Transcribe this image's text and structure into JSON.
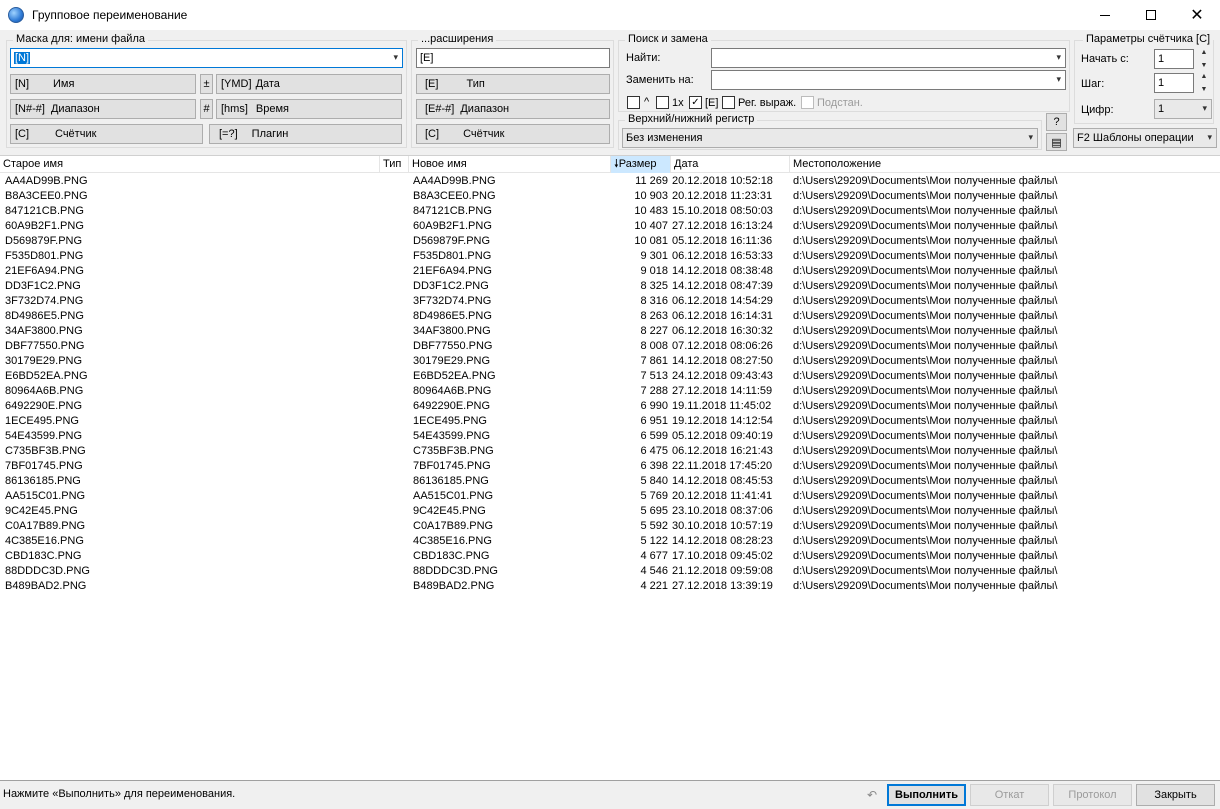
{
  "window": {
    "title": "Групповое переименование",
    "minimize_icon": "minimize-icon",
    "maximize_icon": "maximize-icon",
    "close_icon": "close-icon"
  },
  "filename_mask": {
    "title": "Маска для: имени файла",
    "value": "[N]",
    "buttons": [
      {
        "code": "[N]",
        "label": "Имя"
      },
      {
        "code": "[N#-#]",
        "label": "Диапазон"
      },
      {
        "code": "[C]",
        "label": "Счётчик"
      }
    ],
    "plus": "±",
    "hash": "#",
    "buttons_right": [
      {
        "code": "[YMD]",
        "label": "Дата"
      },
      {
        "code": "[hms]",
        "label": "Время"
      },
      {
        "code": "[=?]",
        "label": "Плагин"
      }
    ]
  },
  "extension_mask": {
    "title": "...расширения",
    "value": "[E]",
    "buttons": [
      {
        "code": "[E]",
        "label": "Тип"
      },
      {
        "code": "[E#-#]",
        "label": "Диапазон"
      },
      {
        "code": "[C]",
        "label": "Счётчик"
      }
    ]
  },
  "search_replace": {
    "title": "Поиск и замена",
    "find_label": "Найти:",
    "find_value": "",
    "replace_label": "Заменить на:",
    "replace_value": "",
    "opt_caret": "^",
    "opt_1x": "1x",
    "opt_ext": "[E]",
    "opt_regex": "Рег. выраж.",
    "opt_subst": "Подстан.",
    "caret_checked": false,
    "once_checked": false,
    "ext_checked": true,
    "regex_checked": false,
    "subst_checked": false
  },
  "case": {
    "title": "Верхний/нижний регистр",
    "value": "Без изменения",
    "help": "?"
  },
  "counter": {
    "title": "Параметры счётчика [C]",
    "start_label": "Начать с:",
    "start_value": "1",
    "step_label": "Шаг:",
    "step_value": "1",
    "digits_label": "Цифр:",
    "digits_value": "1",
    "templates": "F2 Шаблоны операции"
  },
  "columns": {
    "old": "Старое имя",
    "type": "Тип",
    "new": "Новое имя",
    "size": "Размер",
    "date": "Дата",
    "location": "Местоположение"
  },
  "files": [
    {
      "old": "AA4AD99B.PNG",
      "new": "AA4AD99B.PNG",
      "size": "11 269",
      "date": "20.12.2018 10:52:18",
      "loc": "d:\\Users\\29209\\Documents\\Мои полученные файлы\\"
    },
    {
      "old": "B8A3CEE0.PNG",
      "new": "B8A3CEE0.PNG",
      "size": "10 903",
      "date": "20.12.2018 11:23:31",
      "loc": "d:\\Users\\29209\\Documents\\Мои полученные файлы\\"
    },
    {
      "old": "847121CB.PNG",
      "new": "847121CB.PNG",
      "size": "10 483",
      "date": "15.10.2018 08:50:03",
      "loc": "d:\\Users\\29209\\Documents\\Мои полученные файлы\\"
    },
    {
      "old": "60A9B2F1.PNG",
      "new": "60A9B2F1.PNG",
      "size": "10 407",
      "date": "27.12.2018 16:13:24",
      "loc": "d:\\Users\\29209\\Documents\\Мои полученные файлы\\"
    },
    {
      "old": "D569879F.PNG",
      "new": "D569879F.PNG",
      "size": "10 081",
      "date": "05.12.2018 16:11:36",
      "loc": "d:\\Users\\29209\\Documents\\Мои полученные файлы\\"
    },
    {
      "old": "F535D801.PNG",
      "new": "F535D801.PNG",
      "size": "9 301",
      "date": "06.12.2018 16:53:33",
      "loc": "d:\\Users\\29209\\Documents\\Мои полученные файлы\\"
    },
    {
      "old": "21EF6A94.PNG",
      "new": "21EF6A94.PNG",
      "size": "9 018",
      "date": "14.12.2018 08:38:48",
      "loc": "d:\\Users\\29209\\Documents\\Мои полученные файлы\\"
    },
    {
      "old": "DD3F1C2.PNG",
      "new": "DD3F1C2.PNG",
      "size": "8 325",
      "date": "14.12.2018 08:47:39",
      "loc": "d:\\Users\\29209\\Documents\\Мои полученные файлы\\"
    },
    {
      "old": "3F732D74.PNG",
      "new": "3F732D74.PNG",
      "size": "8 316",
      "date": "06.12.2018 14:54:29",
      "loc": "d:\\Users\\29209\\Documents\\Мои полученные файлы\\"
    },
    {
      "old": "8D4986E5.PNG",
      "new": "8D4986E5.PNG",
      "size": "8 263",
      "date": "06.12.2018 16:14:31",
      "loc": "d:\\Users\\29209\\Documents\\Мои полученные файлы\\"
    },
    {
      "old": "34AF3800.PNG",
      "new": "34AF3800.PNG",
      "size": "8 227",
      "date": "06.12.2018 16:30:32",
      "loc": "d:\\Users\\29209\\Documents\\Мои полученные файлы\\"
    },
    {
      "old": "DBF77550.PNG",
      "new": "DBF77550.PNG",
      "size": "8 008",
      "date": "07.12.2018 08:06:26",
      "loc": "d:\\Users\\29209\\Documents\\Мои полученные файлы\\"
    },
    {
      "old": "30179E29.PNG",
      "new": "30179E29.PNG",
      "size": "7 861",
      "date": "14.12.2018 08:27:50",
      "loc": "d:\\Users\\29209\\Documents\\Мои полученные файлы\\"
    },
    {
      "old": "E6BD52EA.PNG",
      "new": "E6BD52EA.PNG",
      "size": "7 513",
      "date": "24.12.2018 09:43:43",
      "loc": "d:\\Users\\29209\\Documents\\Мои полученные файлы\\"
    },
    {
      "old": "80964A6B.PNG",
      "new": "80964A6B.PNG",
      "size": "7 288",
      "date": "27.12.2018 14:11:59",
      "loc": "d:\\Users\\29209\\Documents\\Мои полученные файлы\\"
    },
    {
      "old": "6492290E.PNG",
      "new": "6492290E.PNG",
      "size": "6 990",
      "date": "19.11.2018 11:45:02",
      "loc": "d:\\Users\\29209\\Documents\\Мои полученные файлы\\"
    },
    {
      "old": "1ECE495.PNG",
      "new": "1ECE495.PNG",
      "size": "6 951",
      "date": "19.12.2018 14:12:54",
      "loc": "d:\\Users\\29209\\Documents\\Мои полученные файлы\\"
    },
    {
      "old": "54E43599.PNG",
      "new": "54E43599.PNG",
      "size": "6 599",
      "date": "05.12.2018 09:40:19",
      "loc": "d:\\Users\\29209\\Documents\\Мои полученные файлы\\"
    },
    {
      "old": "C735BF3B.PNG",
      "new": "C735BF3B.PNG",
      "size": "6 475",
      "date": "06.12.2018 16:21:43",
      "loc": "d:\\Users\\29209\\Documents\\Мои полученные файлы\\"
    },
    {
      "old": "7BF01745.PNG",
      "new": "7BF01745.PNG",
      "size": "6 398",
      "date": "22.11.2018 17:45:20",
      "loc": "d:\\Users\\29209\\Documents\\Мои полученные файлы\\"
    },
    {
      "old": "86136185.PNG",
      "new": "86136185.PNG",
      "size": "5 840",
      "date": "14.12.2018 08:45:53",
      "loc": "d:\\Users\\29209\\Documents\\Мои полученные файлы\\"
    },
    {
      "old": "AA515C01.PNG",
      "new": "AA515C01.PNG",
      "size": "5 769",
      "date": "20.12.2018 11:41:41",
      "loc": "d:\\Users\\29209\\Documents\\Мои полученные файлы\\"
    },
    {
      "old": "9C42E45.PNG",
      "new": "9C42E45.PNG",
      "size": "5 695",
      "date": "23.10.2018 08:37:06",
      "loc": "d:\\Users\\29209\\Documents\\Мои полученные файлы\\"
    },
    {
      "old": "C0A17B89.PNG",
      "new": "C0A17B89.PNG",
      "size": "5 592",
      "date": "30.10.2018 10:57:19",
      "loc": "d:\\Users\\29209\\Documents\\Мои полученные файлы\\"
    },
    {
      "old": "4C385E16.PNG",
      "new": "4C385E16.PNG",
      "size": "5 122",
      "date": "14.12.2018 08:28:23",
      "loc": "d:\\Users\\29209\\Documents\\Мои полученные файлы\\"
    },
    {
      "old": "CBD183C.PNG",
      "new": "CBD183C.PNG",
      "size": "4 677",
      "date": "17.10.2018 09:45:02",
      "loc": "d:\\Users\\29209\\Documents\\Мои полученные файлы\\"
    },
    {
      "old": "88DDDC3D.PNG",
      "new": "88DDDC3D.PNG",
      "size": "4 546",
      "date": "21.12.2018 09:59:08",
      "loc": "d:\\Users\\29209\\Documents\\Мои полученные файлы\\"
    },
    {
      "old": "B489BAD2.PNG",
      "new": "B489BAD2.PNG",
      "size": "4 221",
      "date": "27.12.2018 13:39:19",
      "loc": "d:\\Users\\29209\\Documents\\Мои полученные файлы\\"
    }
  ],
  "status": {
    "text": "Нажмите «Выполнить» для переименования.",
    "run": "Выполнить",
    "rollback": "Откат",
    "log": "Протокол",
    "close": "Закрыть"
  },
  "colors": {
    "accent": "#0078d7",
    "sorted_header": "#cce8ff"
  }
}
